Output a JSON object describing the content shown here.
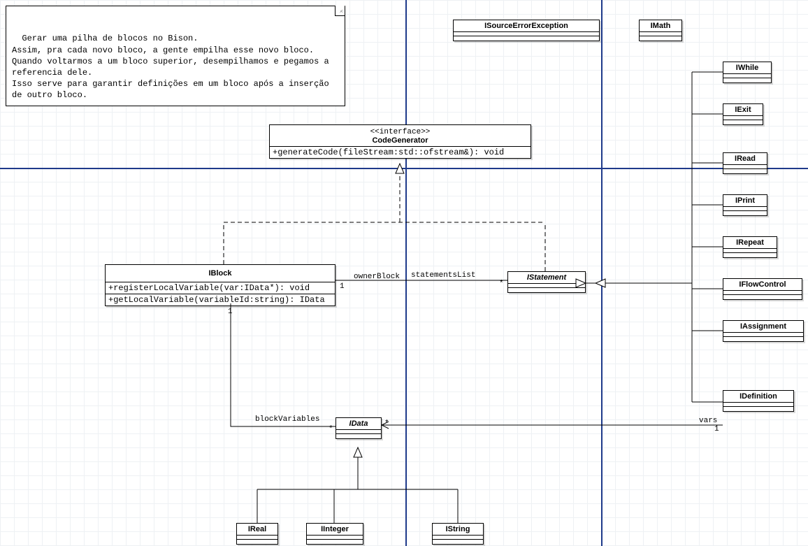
{
  "note": {
    "text": "Gerar uma pilha de blocos no Bison.\nAssim, pra cada novo bloco, a gente empilha esse novo bloco.\nQuando voltarmos a um bloco superior, desempilhamos e pegamos a referencia dele.\nIsso serve para garantir definições em um bloco após a inserção de outro bloco."
  },
  "classes": {
    "codeGenerator": {
      "stereotype": "<<interface>>",
      "name": "CodeGenerator",
      "op1": "+generateCode(fileStream:std::ofstream&): void"
    },
    "iblock": {
      "name": "IBlock",
      "op1": "+registerLocalVariable(var:IData*): void",
      "op2": "+getLocalVariable(variableId:string): IData"
    },
    "istatement": {
      "name": "IStatement"
    },
    "idata": {
      "name": "IData"
    },
    "isourceError": {
      "name": "ISourceErrorException"
    },
    "imath": {
      "name": "IMath"
    },
    "iwhile": {
      "name": "IWhile"
    },
    "iexit": {
      "name": "IExit"
    },
    "iread": {
      "name": "IRead"
    },
    "iprint": {
      "name": "IPrint"
    },
    "irepeat": {
      "name": "IRepeat"
    },
    "iflowcontrol": {
      "name": "IFlowControl"
    },
    "iassignment": {
      "name": "IAssignment"
    },
    "idefinition": {
      "name": "IDefinition"
    },
    "ireal": {
      "name": "IReal"
    },
    "iinteger": {
      "name": "IInteger"
    },
    "istring": {
      "name": "IString"
    }
  },
  "labels": {
    "ownerBlock": "ownerBlock",
    "statementsList": "statementsList",
    "blockVariables": "blockVariables",
    "vars": "vars",
    "one_a": "1",
    "one_b": "1",
    "one_c": "1",
    "star_a": "*",
    "star_b": "*",
    "star_c": "*"
  }
}
